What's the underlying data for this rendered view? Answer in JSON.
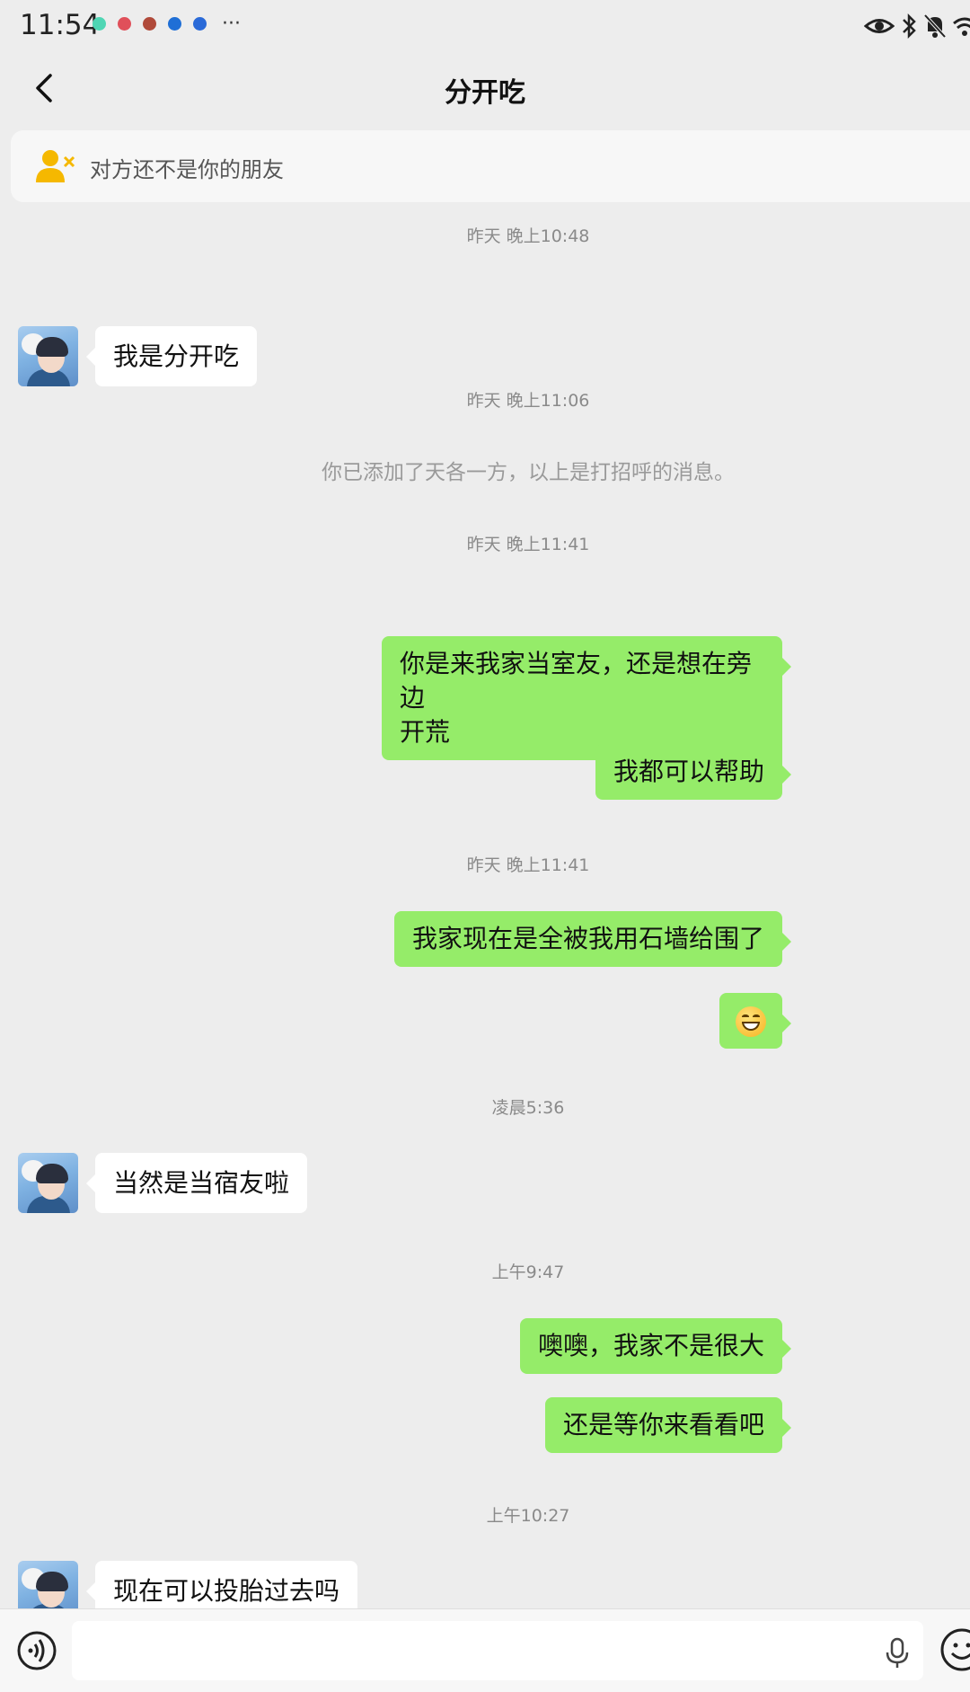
{
  "status_bar": {
    "time": "11:54",
    "notification_icons": [
      {
        "name": "app-green-icon",
        "color": "#4fd6b4"
      },
      {
        "name": "app-red-icon",
        "color": "#e0505a"
      },
      {
        "name": "app-avatar-icon",
        "color": "#b04a3a"
      },
      {
        "name": "app-blue-cloud-icon",
        "color": "#1f6fd6"
      },
      {
        "name": "app-blue-shield-icon",
        "color": "#2a6ad8"
      }
    ],
    "more": "···"
  },
  "header": {
    "title": "分开吃",
    "back_icon": "chevron-left-icon"
  },
  "banner": {
    "icon": "remove-friend-icon",
    "text": "对方还不是你的朋友",
    "accent": "#f5b800"
  },
  "messages": [
    {
      "type": "timestamp",
      "text": "昨天 晚上10:48"
    },
    {
      "type": "incoming",
      "text": "我是分开吃"
    },
    {
      "type": "timestamp",
      "text": "昨天 晚上11:06"
    },
    {
      "type": "system",
      "text": "你已添加了天各一方，以上是打招呼的消息。"
    },
    {
      "type": "timestamp",
      "text": "昨天 晚上11:41"
    },
    {
      "type": "outgoing",
      "lines": [
        "你是来我家当室友，还是想在旁边",
        "开荒"
      ]
    },
    {
      "type": "outgoing",
      "text": "我都可以帮助"
    },
    {
      "type": "timestamp",
      "text": "昨天 晚上11:41"
    },
    {
      "type": "outgoing",
      "text": "我家现在是全被我用石墙给围了"
    },
    {
      "type": "outgoing-emoji",
      "emoji": "grinning-face"
    },
    {
      "type": "timestamp",
      "text": "凌晨5:36"
    },
    {
      "type": "incoming",
      "text": "当然是当宿友啦"
    },
    {
      "type": "timestamp",
      "text": "上午9:47"
    },
    {
      "type": "outgoing",
      "text": "噢噢，我家不是很大"
    },
    {
      "type": "outgoing",
      "text": "还是等你来看看吧"
    },
    {
      "type": "timestamp",
      "text": "上午10:27"
    },
    {
      "type": "incoming",
      "text": "现在可以投胎过去吗"
    }
  ],
  "input_bar": {
    "value": "",
    "voice_icon": "voice-icon",
    "mic_icon": "microphone-icon",
    "emoji_icon": "emoji-icon"
  },
  "colors": {
    "background": "#ededed",
    "outgoing_bubble": "#95ec69",
    "incoming_bubble": "#ffffff"
  }
}
